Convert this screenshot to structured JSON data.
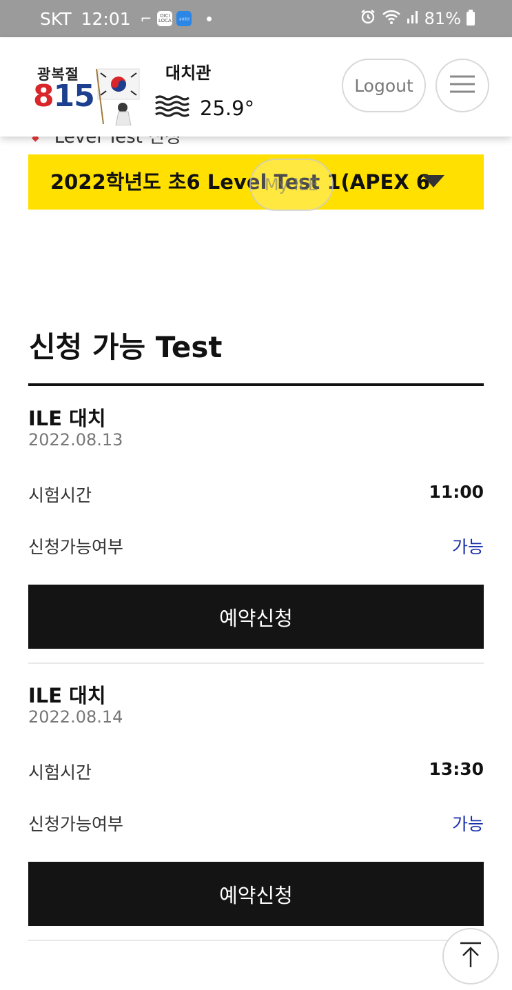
{
  "status_bar": {
    "carrier": "SKT",
    "time": "12:01",
    "mini_icon_1": "DICI\nLOCA",
    "mini_icon_2": "삼성증권",
    "battery": "81%"
  },
  "header": {
    "logo_line1": "광복절",
    "logo_num_8": "8",
    "logo_num_15": "15",
    "branch": "대치관",
    "temperature": "25.9°",
    "logout_label": "Logout",
    "menu_icon": "hamburger-icon",
    "weather_icon": "haze-icon"
  },
  "breadcrumb_peek": "Level Test 신청",
  "selector": {
    "selected": "2022학년도 초6 Level Test 1(APEX 6"
  },
  "floating_button": "My ILE",
  "section": {
    "title": "신청 가능 Test"
  },
  "tests": [
    {
      "name": "ILE 대치",
      "date": "2022.08.13",
      "time_label": "시험시간",
      "time": "11:00",
      "avail_label": "신청가능여부",
      "avail": "가능",
      "reserve_label": "예약신청"
    },
    {
      "name": "ILE 대치",
      "date": "2022.08.14",
      "time_label": "시험시간",
      "time": "13:30",
      "avail_label": "신청가능여부",
      "avail": "가능",
      "reserve_label": "예약신청"
    }
  ],
  "colors": {
    "accent_yellow": "#ffe001",
    "button_black": "#141414",
    "available_blue": "#1a2fa8"
  }
}
